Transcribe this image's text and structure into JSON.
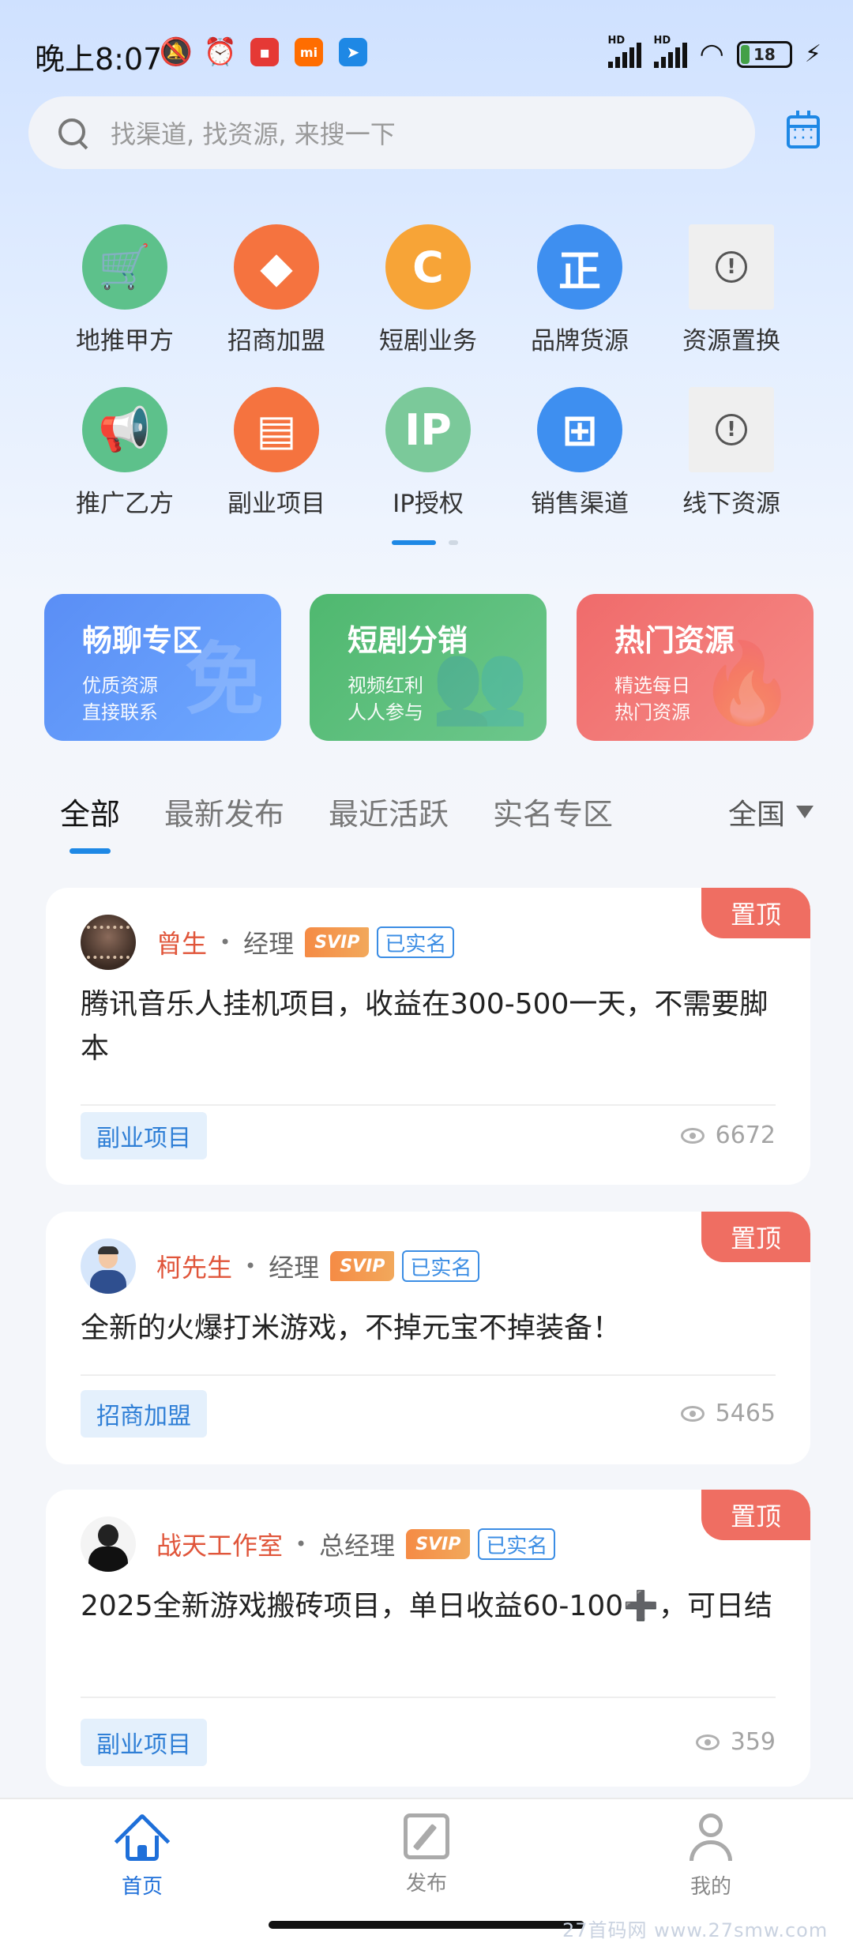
{
  "status_bar": {
    "time": "晚上8:07",
    "battery": "18",
    "net_label_1": "HD",
    "net_label_2": "HD",
    "xiaomi_label": "mi"
  },
  "search": {
    "placeholder": "找渠道, 找资源, 来搜一下"
  },
  "categories": [
    {
      "label": "地推甲方",
      "icon": "cart-icon",
      "color": "#5dc18b"
    },
    {
      "label": "招商加盟",
      "icon": "handshake-icon",
      "color": "#f5733f"
    },
    {
      "label": "短剧业务",
      "icon": "c-icon",
      "glyph": "C",
      "color": "#f7a437"
    },
    {
      "label": "品牌货源",
      "icon": "zheng-icon",
      "glyph": "正",
      "color": "#3e8ff0"
    },
    {
      "label": "资源置换",
      "icon": "placeholder-icon",
      "glyph": "!"
    },
    {
      "label": "推广乙方",
      "icon": "megaphone-icon",
      "color": "#5dc18b"
    },
    {
      "label": "副业项目",
      "icon": "clipboard-icon",
      "color": "#f5733f"
    },
    {
      "label": "IP授权",
      "icon": "ip-icon",
      "glyph": "IP",
      "color": "#7bc99a"
    },
    {
      "label": "销售渠道",
      "icon": "org-chart-icon",
      "color": "#3e8ff0"
    },
    {
      "label": "线下资源",
      "icon": "placeholder-icon",
      "glyph": "!"
    }
  ],
  "banners": [
    {
      "title": "畅聊专区",
      "line1": "优质资源",
      "line2": "直接联系",
      "deco": "免"
    },
    {
      "title": "短剧分销",
      "line1": "视频红利",
      "line2": "人人参与"
    },
    {
      "title": "热门资源",
      "line1": "精选每日",
      "line2": "热门资源"
    }
  ],
  "tabs": [
    "全部",
    "最新发布",
    "最近活跃",
    "实名专区"
  ],
  "region": "全国",
  "posts": [
    {
      "pin": "置顶",
      "author": "曾生",
      "title": "经理",
      "svip": "SVIP",
      "verified": "已实名",
      "text": "腾讯音乐人挂机项目，收益在300-500一天，不需要脚本",
      "tag": "副业项目",
      "views": "6672"
    },
    {
      "pin": "置顶",
      "author": "柯先生",
      "title": "经理",
      "svip": "SVIP",
      "verified": "已实名",
      "text": "全新的火爆打米游戏，不掉元宝不掉装备！",
      "tag": "招商加盟",
      "views": "5465"
    },
    {
      "pin": "置顶",
      "author": "战天工作室",
      "title": "总经理",
      "svip": "SVIP",
      "verified": "已实名",
      "text": "2025全新游戏搬砖项目，单日收益60-100➕，可日结",
      "tag": "副业项目",
      "views": "359"
    }
  ],
  "separator": "•",
  "nav": {
    "home": "首页",
    "post": "发布",
    "me": "我的"
  },
  "watermark": "27首码网 www.27smw.com",
  "colors": {
    "accent": "#1e88e5",
    "author_name": "#e0553a",
    "pin_badge": "#ef6e62"
  }
}
